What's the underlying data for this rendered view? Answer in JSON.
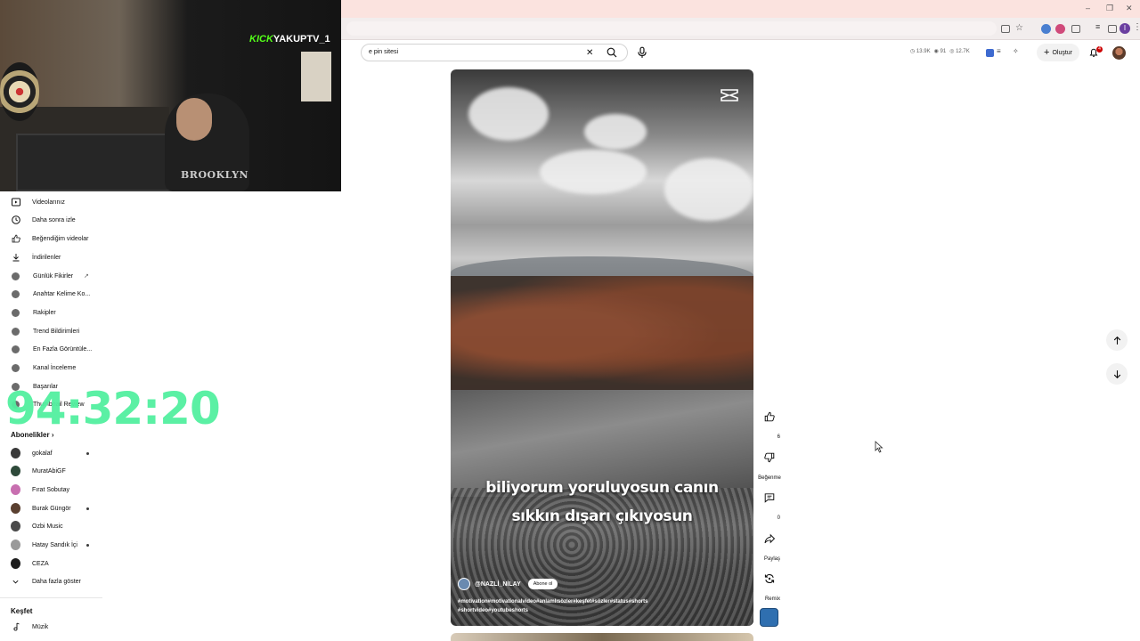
{
  "stream": {
    "overlay_brand": "KICK",
    "overlay_channel": "YAKUPTV_1",
    "shirt_text": "BROOKLYN",
    "timer": "94:32:20"
  },
  "browser": {
    "window_controls": [
      "–",
      "❐",
      "✕"
    ],
    "profile_initial": "I"
  },
  "search": {
    "query": "e pin sitesi"
  },
  "header_stats": {
    "views": "13.9K",
    "watching": "91",
    "subs": "12.7K"
  },
  "create_label": "Oluştur",
  "notifications_count": "4",
  "sidebar": {
    "you_items": [
      {
        "label": "Videolarınız",
        "icon": "video-icon"
      },
      {
        "label": "Daha sonra izle",
        "icon": "clock-icon"
      },
      {
        "label": "Beğendiğim videolar",
        "icon": "thumbs-up-icon"
      },
      {
        "label": "İndirilenler",
        "icon": "download-icon"
      }
    ],
    "tool_items": [
      {
        "label": "Günlük Fikirler",
        "external": true
      },
      {
        "label": "Anahtar Kelime Ko..."
      },
      {
        "label": "Rakipler"
      },
      {
        "label": "Trend Bildirimleri"
      },
      {
        "label": "En Fazla Görüntüle..."
      },
      {
        "label": "Kanal İnceleme"
      },
      {
        "label": "Başarılar"
      },
      {
        "label": "Thumbnail Review"
      }
    ],
    "subscriptions_heading": "Abonelikler",
    "subscriptions": [
      {
        "label": "gokalaf",
        "color": "#3a3a3a",
        "new": true
      },
      {
        "label": "MuratAbiGF",
        "color": "#2e4a3a",
        "new": false
      },
      {
        "label": "Fırat Sobutay",
        "color": "#c86fb0",
        "new": false
      },
      {
        "label": "Burak Güngör",
        "color": "#5a4030",
        "new": true
      },
      {
        "label": "Ozbi Music",
        "color": "#4a4a4a",
        "new": false
      },
      {
        "label": "Hatay Sandık İçi",
        "color": "#9a9a9a",
        "new": true
      },
      {
        "label": "CEZA",
        "color": "#1e1e1e",
        "new": false
      }
    ],
    "show_more": "Daha fazla göster",
    "explore_heading": "Keşfet",
    "explore_items": [
      {
        "label": "Müzik",
        "icon": "music-note-icon"
      }
    ]
  },
  "short": {
    "caption_line1": "biliyorum yoruluyosun canın",
    "caption_line2": "sıkkın dışarı çıkıyosun",
    "channel": "@NAZLİ_NİLAY",
    "subscribe": "Abone ol",
    "hashtags_line1": "#motivation#motivationalvideo#anlamlısözler#keşfet#sözler#status#shorts",
    "hashtags_line2": "#shortvideo#youtubeshorts"
  },
  "actions": {
    "like_count": "6",
    "dislike_label": "Beğenme",
    "comment_count": "0",
    "share_label": "Paylaş",
    "remix_label": "Remix"
  },
  "colors": {
    "timer": "#53f0a0",
    "kick_green": "#53fc18",
    "notification_red": "#cc0000",
    "titlebar": "#fbe3df"
  }
}
